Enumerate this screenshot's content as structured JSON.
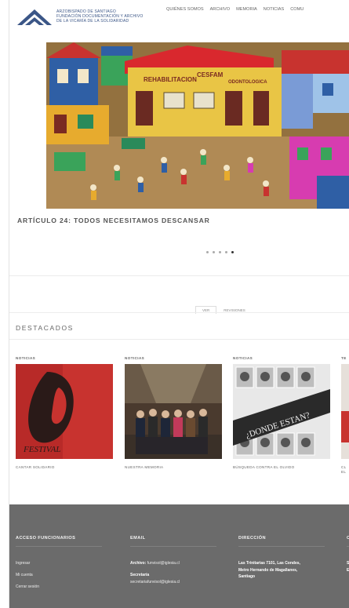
{
  "header": {
    "org_lines": [
      "ARZOBISPADO DE SANTIAGO",
      "FUNDACIÓN DOCUMENTACIÓN Y ARCHIVO",
      "DE LA VICARÍA DE LA SOLIDARIDAD"
    ],
    "nav": [
      "QUIÉNES SOMOS",
      "ARCHIVO",
      "MEMORIA",
      "NOTICIAS",
      "COMU"
    ]
  },
  "hero": {
    "banner_text": "REHABILITACION",
    "banner_text2": "CESFAM",
    "banner_text3": "ODONTOLOGICA",
    "title": "ARTÍCULO 24: TODOS NECESITAMOS DESCANSAR",
    "slide_count": 5,
    "active_slide": 5
  },
  "tabs": {
    "view": "VER",
    "revisions": "REVISIONES"
  },
  "featured": {
    "title": "DESTACADOS",
    "cards": [
      {
        "category": "NOTICIAS",
        "title": "CANTAR SOLIDARIO",
        "image_text": "FESTIVAL"
      },
      {
        "category": "NOTICIAS",
        "title": "NUESTRA MEMORIA"
      },
      {
        "category": "NOTICIAS",
        "title": "BÚSQUEDA CONTRA EL OLVIDO",
        "image_text": "¿DONDE ESTAN?"
      },
      {
        "category": "TE",
        "title": "CL EL"
      }
    ]
  },
  "footer": {
    "columns": [
      {
        "heading": "ACCESO FUNCIONARIOS",
        "links": [
          "Ingresar",
          "Mi cuenta",
          "Cerrar sesión"
        ]
      },
      {
        "heading": "EMAIL",
        "entries": [
          {
            "label": "Archivo:",
            "value": "funvisol@iglesia.cl"
          },
          {
            "label": "Secretaría",
            "value": "secretariafunvisol@iglesia.cl"
          }
        ]
      },
      {
        "heading": "DIRECCIÓN",
        "lines": [
          "Las Trinitarias 7101, Las Condes,",
          "Metro Hernando de Magallanes,",
          "Santiago"
        ]
      },
      {
        "heading": "C",
        "lines": [
          "S",
          "E"
        ]
      }
    ]
  },
  "colors": {
    "brand_blue": "#3b5687",
    "footer_bg": "#6b6b6b",
    "accent_red": "#c8332f"
  }
}
